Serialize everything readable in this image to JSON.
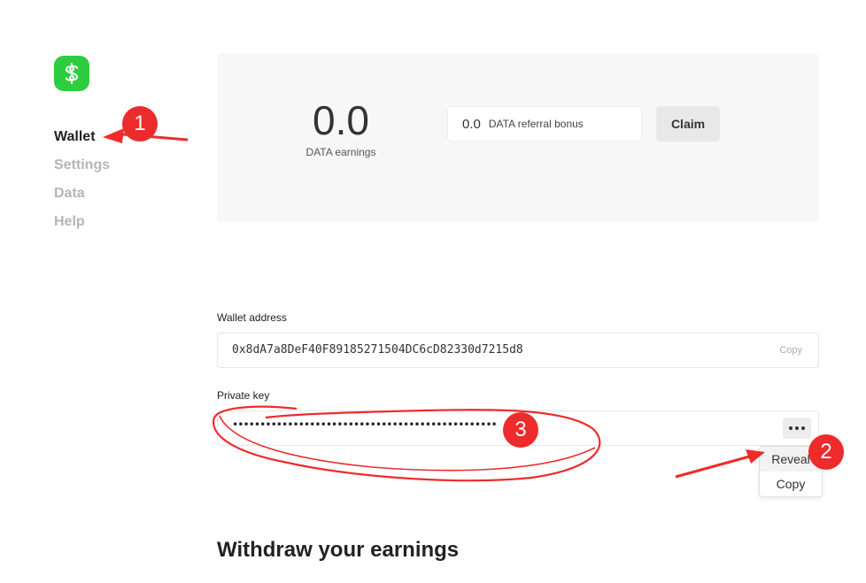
{
  "sidebar": {
    "logo_icon": "dollar-swirl-icon",
    "logo_color": "#2ecc40",
    "items": [
      {
        "label": "Wallet",
        "active": true
      },
      {
        "label": "Settings",
        "active": false
      },
      {
        "label": "Data",
        "active": false
      },
      {
        "label": "Help",
        "active": false
      }
    ]
  },
  "earnings": {
    "value": "0.0",
    "label": "DATA earnings",
    "bonus_value": "0.0",
    "bonus_label": "DATA referral bonus",
    "claim_label": "Claim"
  },
  "wallet_address": {
    "label": "Wallet address",
    "value": "0x8dA7a8DeF40F89185271504DC6cD82330d7215d8",
    "copy_label": "Copy"
  },
  "private_key": {
    "label": "Private key",
    "masked_value": "••••••••••••••••••••••••••••••••••••••••••••••••••••••••••••••••••••",
    "more_icon": "ellipsis-icon",
    "menu": [
      {
        "label": "Reveal",
        "hover": true
      },
      {
        "label": "Copy",
        "hover": false
      }
    ]
  },
  "withdraw": {
    "title": "Withdraw your earnings"
  },
  "annotations": {
    "color": "#ee2b2b",
    "badges": [
      "1",
      "2",
      "3"
    ]
  }
}
